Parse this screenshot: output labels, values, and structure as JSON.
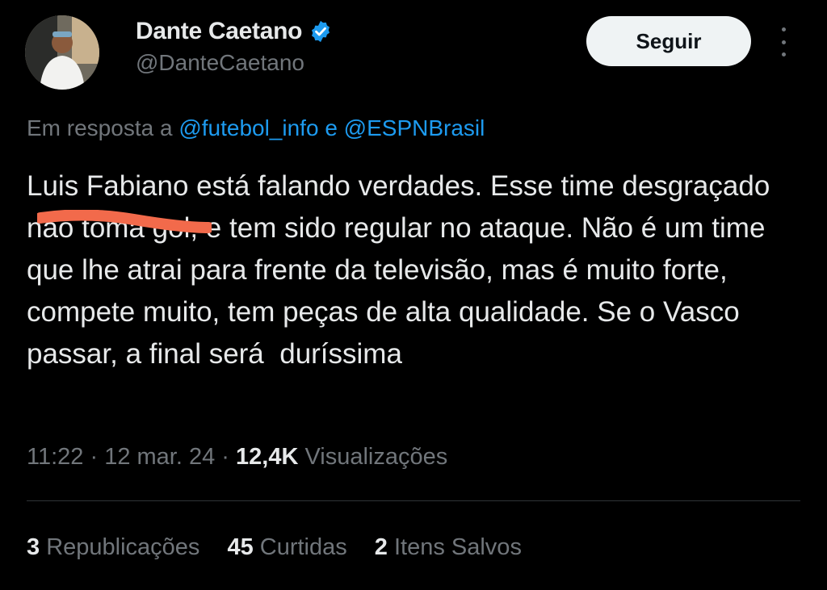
{
  "author": {
    "name": "Dante Caetano",
    "handle": "@DanteCaetano",
    "verified_icon": "verified-badge-icon"
  },
  "follow_label": "Seguir",
  "reply": {
    "prefix": "Em resposta a",
    "mention1": "@futebol_info",
    "conj": "e",
    "mention2": "@ESPNBrasil"
  },
  "tweet_text": "Luis Fabiano está falando verdades. Esse time desgraçado não toma gol, e tem sido regular no ataque. Não é um time que lhe atrai para frente da televisão, mas é muito forte, compete muito, tem peças de alta qualidade. Se o Vasco passar, a final será  duríssima",
  "meta": {
    "time": "11:22",
    "date": "12 mar. 24",
    "views_count": "12,4K",
    "views_label": "Visualizações"
  },
  "stats": {
    "reposts_count": "3",
    "reposts_label": "Republicações",
    "likes_count": "45",
    "likes_label": "Curtidas",
    "saves_count": "2",
    "saves_label": "Itens Salvos"
  },
  "colors": {
    "background": "#000000",
    "text": "#e7e9ea",
    "secondary": "#71767b",
    "link": "#1d9bf0",
    "redaction": "#f26a4b"
  }
}
